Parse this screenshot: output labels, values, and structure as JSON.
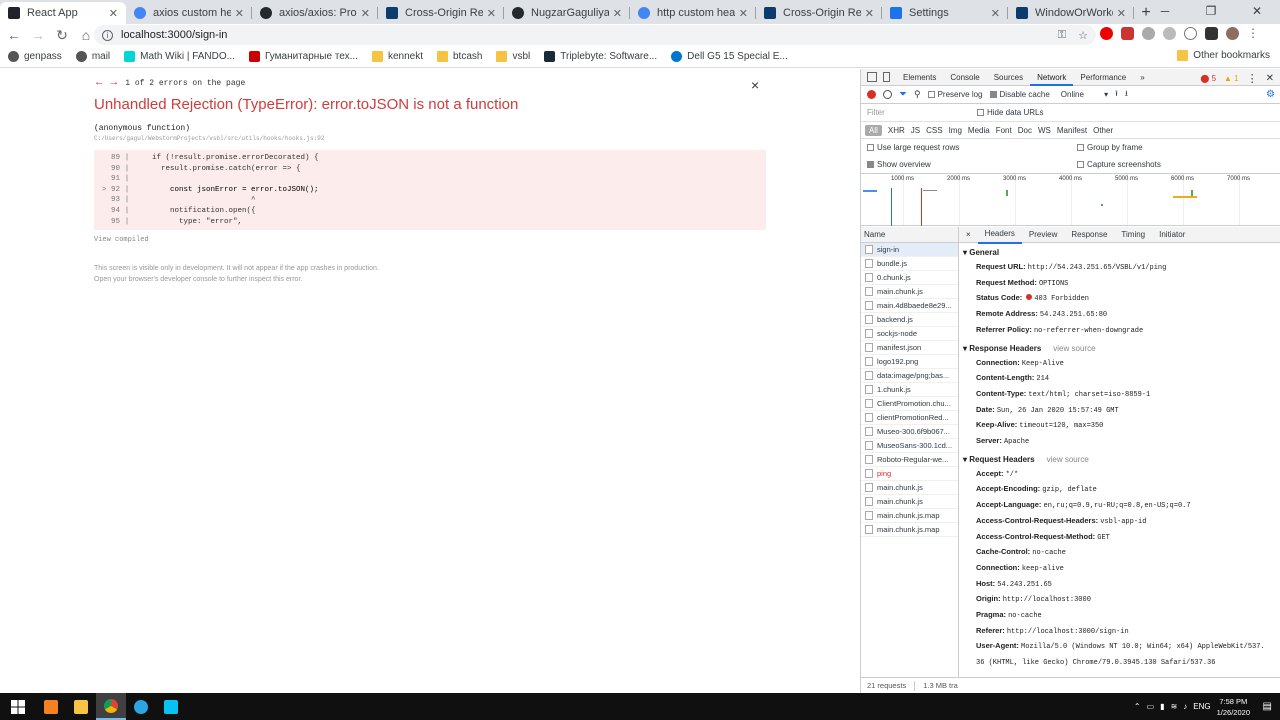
{
  "tabs": [
    {
      "title": "React App",
      "active": true,
      "icon": "react-icon",
      "color": "#20232a"
    },
    {
      "title": "axios custom headers - ",
      "icon": "google-icon",
      "color": "#4285f4"
    },
    {
      "title": "axios/axios: Promise ba",
      "icon": "github-icon",
      "color": "#24292e"
    },
    {
      "title": "Cross-Origin Resource",
      "icon": "mdn-icon",
      "color": "#0a3c6e"
    },
    {
      "title": "NugzarGaguliya/vsbl",
      "icon": "github-icon",
      "color": "#24292e"
    },
    {
      "title": "http custom headers -",
      "icon": "google-icon",
      "color": "#4285f4"
    },
    {
      "title": "Cross-Origin Resource",
      "icon": "mdn-icon",
      "color": "#0a3c6e"
    },
    {
      "title": "Settings",
      "icon": "gear-icon",
      "color": "#1a73e8"
    },
    {
      "title": "WindowOrWorkerGlob",
      "icon": "mdn-icon",
      "color": "#0a3c6e"
    }
  ],
  "newtab": "+",
  "window": {
    "min": "─",
    "max": "❐",
    "close": "✕"
  },
  "omnibox": {
    "url": "localhost:3000/sign-in",
    "info": "i",
    "key_icon": "⚿",
    "star_icon": "☆"
  },
  "bookmarks": [
    {
      "label": "genpass",
      "icon": "globe-icon",
      "color": "#555"
    },
    {
      "label": "mail",
      "icon": "globe-icon",
      "color": "#555"
    },
    {
      "label": "Math Wiki | FANDO...",
      "icon": "fandom-icon",
      "color": "#00d6d6"
    },
    {
      "label": "Гуманитарные тех...",
      "icon": "site-icon",
      "color": "#c00"
    },
    {
      "label": "kennekt",
      "icon": "folder-icon",
      "color": "#f6c344"
    },
    {
      "label": "btcash",
      "icon": "folder-icon",
      "color": "#f6c344"
    },
    {
      "label": "vsbl",
      "icon": "folder-icon",
      "color": "#f6c344"
    },
    {
      "label": "Triplebyte: Software...",
      "icon": "triplebyte-icon",
      "color": "#1b2a3a"
    },
    {
      "label": "Dell G5 15 Special E...",
      "icon": "dell-icon",
      "color": "#0076ce"
    }
  ],
  "other_bookmarks": "Other bookmarks",
  "overlay": {
    "nav_prev": "←",
    "nav_next": "→",
    "nav_text": "1 of 2 errors on the page",
    "close": "×",
    "title": "Unhandled Rejection (TypeError): error.toJSON is not a function",
    "function": "(anonymous function)",
    "path": "C:/Users/gagul/WebstormProjects/vsbl/src/utils/hooks/hooks.js:92",
    "code": [
      {
        "num": "89",
        "bar": "|",
        "src": "    if (!result.promise.errorDecorated) {",
        "hl": false
      },
      {
        "num": "90",
        "bar": "|",
        "src": "      result.promise.catch(error => {",
        "hl": false
      },
      {
        "num": "91",
        "bar": "|",
        "src": "",
        "hl": false
      },
      {
        "num": "> 92",
        "bar": "|",
        "src": "        const jsonError = error.toJSON();",
        "hl": true
      },
      {
        "num": "93",
        "bar": "|",
        "src": "                          ^",
        "hl": false
      },
      {
        "num": "94",
        "bar": "|",
        "src": "        notification.open({",
        "hl": false
      },
      {
        "num": "95",
        "bar": "|",
        "src": "          type: \"error\",",
        "hl": false
      }
    ],
    "view_compiled": "View compiled",
    "note1": "This screen is visible only in development. It will not appear if the app crashes in production.",
    "note2": "Open your browser's developer console to further inspect this error."
  },
  "devtools": {
    "tabs": [
      "Elements",
      "Console",
      "Sources",
      "Network",
      "Performance",
      "»"
    ],
    "active_tab": "Network",
    "errors": "5",
    "warnings": "1",
    "preserve_log": "Preserve log",
    "disable_cache": "Disable cache",
    "throttle": "Online",
    "filter_placeholder": "Filter",
    "hide_data_urls": "Hide data URLs",
    "types": [
      "All",
      "XHR",
      "JS",
      "CSS",
      "Img",
      "Media",
      "Font",
      "Doc",
      "WS",
      "Manifest",
      "Other"
    ],
    "opt_large": "Use large request rows",
    "opt_group": "Group by frame",
    "opt_overview": "Show overview",
    "opt_capture": "Capture screenshots",
    "ticks": [
      "1000 ms",
      "2000 ms",
      "3000 ms",
      "4000 ms",
      "5000 ms",
      "6000 ms",
      "7000 ms"
    ],
    "name_header": "Name",
    "requests": [
      "sign-in",
      "bundle.js",
      "0.chunk.js",
      "main.chunk.js",
      "main.4d8baede8e29...",
      "backend.js",
      "sockjs-node",
      "manifest.json",
      "logo192.png",
      "data:image/png;bas...",
      "1.chunk.js",
      "ClientPromotion.chu...",
      "clientPromotionRed...",
      "Museo-300.6f9b067...",
      "MuseoSans-300.1cd...",
      "Roboto-Regular-we...",
      "ping",
      "main.chunk.js",
      "main.chunk.js",
      "main.chunk.js.map",
      "main.chunk.js.map"
    ],
    "footer_requests": "21 requests",
    "footer_size": "1.3 MB tra",
    "detail_tabs": [
      "×",
      "Headers",
      "Preview",
      "Response",
      "Timing",
      "Initiator"
    ],
    "general_title": "General",
    "general": [
      {
        "k": "Request URL:",
        "v": "http://54.243.251.65/VSBL/v1/ping"
      },
      {
        "k": "Request Method:",
        "v": "OPTIONS"
      },
      {
        "k": "Status Code:",
        "v": "403 Forbidden"
      },
      {
        "k": "Remote Address:",
        "v": "54.243.251.65:80"
      },
      {
        "k": "Referrer Policy:",
        "v": "no-referrer-when-downgrade"
      }
    ],
    "response_title": "Response Headers",
    "view_source": "view source",
    "response": [
      {
        "k": "Connection:",
        "v": "Keep-Alive"
      },
      {
        "k": "Content-Length:",
        "v": "214"
      },
      {
        "k": "Content-Type:",
        "v": "text/html; charset=iso-8859-1"
      },
      {
        "k": "Date:",
        "v": "Sun, 26 Jan 2020 15:57:49 GMT"
      },
      {
        "k": "Keep-Alive:",
        "v": "timeout=120, max=350"
      },
      {
        "k": "Server:",
        "v": "Apache"
      }
    ],
    "request_title": "Request Headers",
    "request": [
      {
        "k": "Accept:",
        "v": "*/*"
      },
      {
        "k": "Accept-Encoding:",
        "v": "gzip, deflate"
      },
      {
        "k": "Accept-Language:",
        "v": "en,ru;q=0.9,ru-RU;q=0.8,en-US;q=0.7"
      },
      {
        "k": "Access-Control-Request-Headers:",
        "v": "vsbl-app-id"
      },
      {
        "k": "Access-Control-Request-Method:",
        "v": "GET"
      },
      {
        "k": "Cache-Control:",
        "v": "no-cache"
      },
      {
        "k": "Connection:",
        "v": "keep-alive"
      },
      {
        "k": "Host:",
        "v": "54.243.251.65"
      },
      {
        "k": "Origin:",
        "v": "http://localhost:3000"
      },
      {
        "k": "Pragma:",
        "v": "no-cache"
      },
      {
        "k": "Referer:",
        "v": "http://localhost:3000/sign-in"
      },
      {
        "k": "User-Agent:",
        "v": "Mozilla/5.0 (Windows NT 10.0; Win64; x64) AppleWebKit/537."
      },
      {
        "k": "",
        "v": "36 (KHTML, like Gecko) Chrome/79.0.3945.130 Safari/537.36"
      }
    ]
  },
  "taskbar": {
    "lang": "ENG",
    "time": "7:58 PM",
    "date": "1/26/2020"
  },
  "colors": {
    "error_red": "#d23b3b",
    "accent": "#1a73e8",
    "taskbar": "#101010"
  }
}
